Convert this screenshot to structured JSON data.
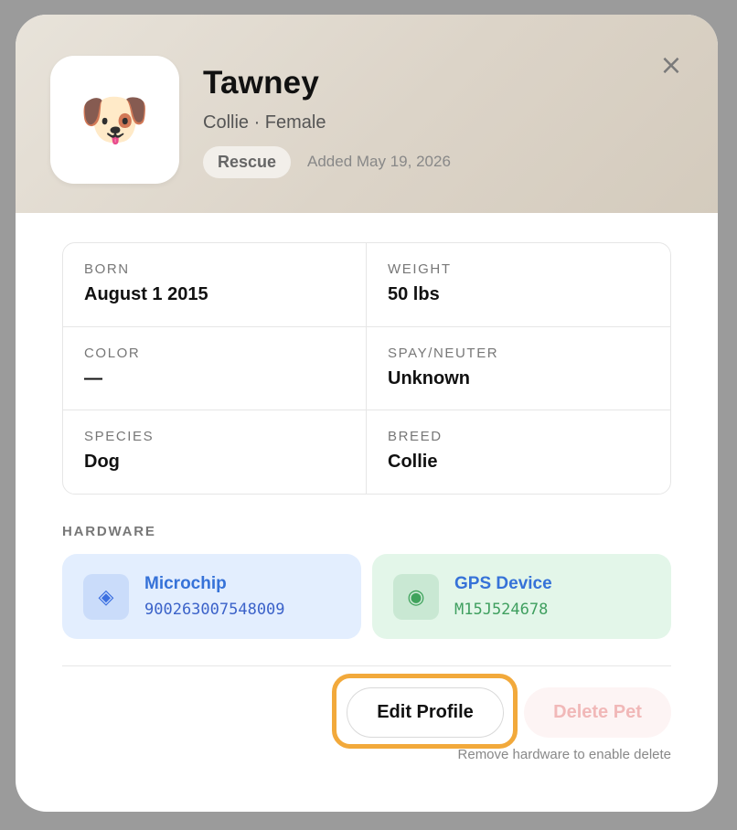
{
  "pet": {
    "avatar_emoji": "🐶",
    "name": "Tawney",
    "subtitle": "Collie · Female",
    "badge": "Rescue",
    "added": "Added May 19, 2026"
  },
  "close_icon": "×",
  "details": {
    "born": {
      "label": "BORN",
      "value": "August 1 2015"
    },
    "weight": {
      "label": "WEIGHT",
      "value": "50 lbs"
    },
    "color": {
      "label": "COLOR",
      "value": "—"
    },
    "spay_neuter": {
      "label": "SPAY/NEUTER",
      "value": "Unknown"
    },
    "species": {
      "label": "SPECIES",
      "value": "Dog"
    },
    "breed": {
      "label": "BREED",
      "value": "Collie"
    }
  },
  "hardware": {
    "title": "HARDWARE",
    "microchip": {
      "icon": "◈",
      "name": "Microchip",
      "id": "900263007548009"
    },
    "gps": {
      "icon": "◉",
      "name": "GPS Device",
      "id": "M15J524678"
    }
  },
  "actions": {
    "edit_label": "Edit Profile",
    "delete_label": "Delete Pet",
    "delete_hint": "Remove hardware to enable delete"
  },
  "colors": {
    "focus_ring": "#f2a93b",
    "link_blue": "#3672d8",
    "gps_green": "#3f9f5f"
  }
}
